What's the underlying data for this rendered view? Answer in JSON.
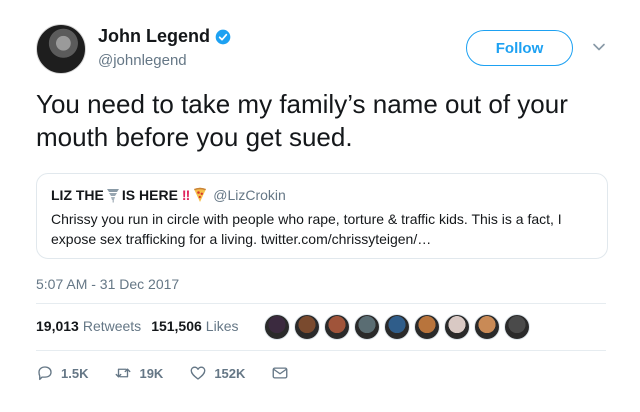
{
  "author": {
    "name": "John Legend",
    "handle": "@johnlegend",
    "verified": true
  },
  "follow_button": {
    "label": "Follow"
  },
  "tweet": {
    "text": "You need to take my family’s name out of your mouth before you get sued."
  },
  "quoted_tweet": {
    "name_part1": "LIZ THE",
    "name_emoji_tornado": "tornado-icon",
    "name_part2": "IS HERE",
    "name_bangs": "!!",
    "name_emoji_pizza": "pizza-icon",
    "handle": "@LizCrokin",
    "text": "Chrissy you run in circle with people who rape, torture & traffic kids. This is a fact, I expose sex trafficking for a living. twitter.com/chrissyteigen/…"
  },
  "timestamp": "5:07 AM - 31 Dec 2017",
  "stats": {
    "retweets_count": "19,013",
    "retweets_label": "Retweets",
    "likes_count": "151,506",
    "likes_label": "Likes"
  },
  "actions": {
    "replies": "1.5K",
    "retweets": "19K",
    "likes": "152K"
  },
  "colors": {
    "brand_blue": "#1da1f2",
    "muted_text": "#657786",
    "border": "#e1e8ed"
  },
  "likers": [
    {
      "color": "#3b2a3f"
    },
    {
      "color": "#7a4a2e"
    },
    {
      "color": "#a0543a"
    },
    {
      "color": "#5a6d73"
    },
    {
      "color": "#2f5d8a"
    },
    {
      "color": "#b8743c"
    },
    {
      "color": "#d9c9c4"
    },
    {
      "color": "#c98a56"
    },
    {
      "color": "#4a4a4a"
    }
  ]
}
